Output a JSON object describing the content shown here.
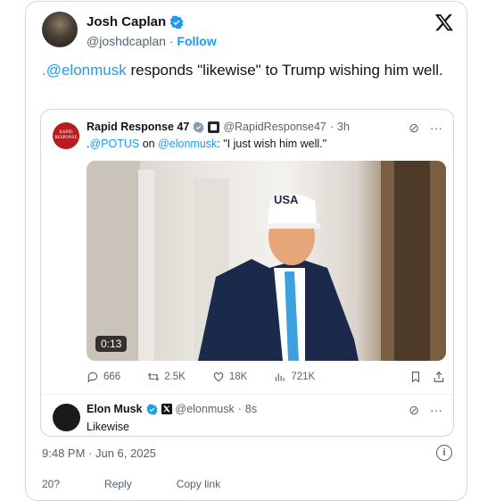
{
  "author": {
    "name": "Josh Caplan",
    "handle": "@joshdcaplan",
    "follow_label": "Follow"
  },
  "tweet": {
    "mention": ".@elonmusk",
    "text": " responds \"likewise\" to Trump wishing him well."
  },
  "quoted": {
    "name": "Rapid Response 47",
    "avatar_text": "RAPID RESPONSE",
    "handle": "@RapidResponse47",
    "time": "3h",
    "text_prefix": ".",
    "mention1": "@POTUS",
    "text_mid": " on ",
    "mention2": "@elonmusk",
    "text_after": ": \"I just wish him well.\"",
    "video_duration": "0:13",
    "hat_text": "USA",
    "stats": {
      "replies": "666",
      "reposts": "2.5K",
      "likes": "18K",
      "views": "721K"
    }
  },
  "reply": {
    "name": "Elon Musk",
    "handle": "@elonmusk",
    "time": "8s",
    "text": "Likewise"
  },
  "timestamp": "9:48 PM · Jun 6, 2025",
  "bottom_partial": {
    "a": "20?",
    "b": "Reply",
    "c": "Copy link"
  },
  "colors": {
    "accent": "#1d9bf0",
    "text": "#0f1419",
    "muted": "#536471"
  }
}
